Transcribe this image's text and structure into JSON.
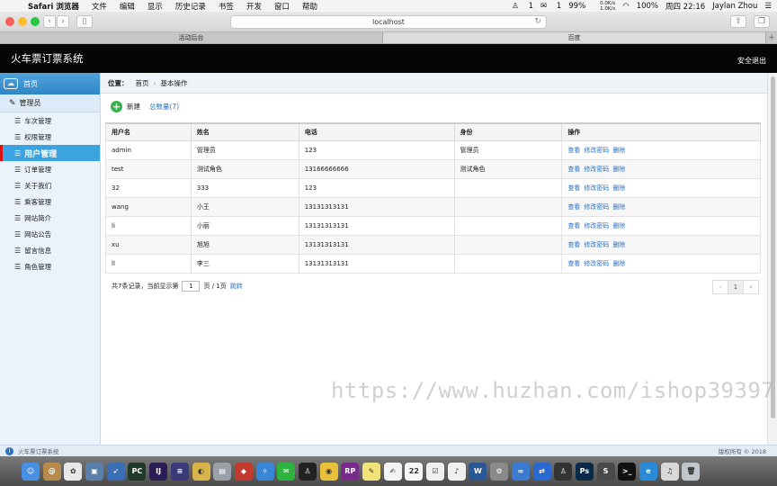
{
  "menubar": {
    "app": "Safari 浏览器",
    "items": [
      "文件",
      "编辑",
      "显示",
      "历史记录",
      "书签",
      "开发",
      "窗口",
      "帮助"
    ],
    "status": {
      "qq_count": "1",
      "wechat_count": "1",
      "percent": "99%",
      "net_up": "0.0K/s",
      "net_down": "1.0K/s",
      "battery": "100%",
      "clock": "周四 22:16",
      "user": "Jaylan Zhou"
    }
  },
  "browser": {
    "url": "localhost",
    "tabs": [
      "活动后台",
      "百度"
    ]
  },
  "header": {
    "title": "火车票订票系统",
    "logout": "安全退出"
  },
  "sidebar": {
    "home": "首页",
    "section": "管理员",
    "items": [
      "车次管理",
      "权限管理",
      "用户管理",
      "订单管理",
      "关于我们",
      "乘客管理",
      "网站简介",
      "网站公告",
      "留言信息",
      "角色管理"
    ],
    "active_index": 2
  },
  "breadcrumb": {
    "label": "位置：",
    "home": "首页",
    "current": "基本操作"
  },
  "actions": {
    "new": "新建",
    "total": "总数量(7)"
  },
  "table": {
    "columns": [
      "用户名",
      "姓名",
      "电话",
      "身份",
      "操作"
    ],
    "rows": [
      {
        "username": "admin",
        "name": "管理员",
        "phone": "123",
        "role": "管理员"
      },
      {
        "username": "test",
        "name": "测试角色",
        "phone": "13166666666",
        "role": "测试角色"
      },
      {
        "username": "32",
        "name": "333",
        "phone": "123",
        "role": ""
      },
      {
        "username": "wang",
        "name": "小王",
        "phone": "13131313131",
        "role": ""
      },
      {
        "username": "li",
        "name": "小丽",
        "phone": "13131313131",
        "role": ""
      },
      {
        "username": "xu",
        "name": "旭旭",
        "phone": "13131313131",
        "role": ""
      },
      {
        "username": "ll",
        "name": "李三",
        "phone": "13131313131",
        "role": ""
      }
    ],
    "ops": [
      "查看",
      "修改密码",
      "删除"
    ]
  },
  "pager": {
    "summary": "共7条记录，当前显示第",
    "page": "1",
    "of": "页 / 1页",
    "jump": "跳转",
    "current": "1",
    "prev": "‹",
    "next": "›"
  },
  "watermark": "https://www.huzhan.com/ishop39397",
  "statusbar": {
    "left": "火车票订票系统",
    "right": "版权所有 © 2018"
  },
  "dock": [
    {
      "name": "finder-icon",
      "color": "#4a90e2",
      "glyph": "☺"
    },
    {
      "name": "contacts-icon",
      "color": "#b88a4a",
      "glyph": "@"
    },
    {
      "name": "photos-icon",
      "color": "#e8e8e8",
      "glyph": "✿"
    },
    {
      "name": "preview-icon",
      "color": "#5a7fa8",
      "glyph": "▣"
    },
    {
      "name": "launchpad-icon",
      "color": "#3b6fb5",
      "glyph": "➶"
    },
    {
      "name": "pycharm-icon",
      "color": "#1f3a2a",
      "glyph": "PC"
    },
    {
      "name": "intellij-icon",
      "color": "#2b1d55",
      "glyph": "IJ"
    },
    {
      "name": "eclipse-icon",
      "color": "#3a3a7a",
      "glyph": "≡"
    },
    {
      "name": "squirrel-icon",
      "color": "#d8b44a",
      "glyph": "◐"
    },
    {
      "name": "db-icon",
      "color": "#9aa0a8",
      "glyph": "▤"
    },
    {
      "name": "redis-icon",
      "color": "#c23a2e",
      "glyph": "◆"
    },
    {
      "name": "safari-icon",
      "color": "#3a86d6",
      "glyph": "✧"
    },
    {
      "name": "wechat-icon",
      "color": "#2fb33f",
      "glyph": "✉"
    },
    {
      "name": "qq-icon",
      "color": "#222222",
      "glyph": "♙"
    },
    {
      "name": "chrome-icon",
      "color": "#e8c13a",
      "glyph": "◉"
    },
    {
      "name": "axure-icon",
      "color": "#7a2a8a",
      "glyph": "RP"
    },
    {
      "name": "notes-icon",
      "color": "#f2e27a",
      "glyph": "✎"
    },
    {
      "name": "textedit-icon",
      "color": "#f4f4f4",
      "glyph": "✍"
    },
    {
      "name": "calendar-icon",
      "color": "#f8f8f8",
      "glyph": "22"
    },
    {
      "name": "reminders-icon",
      "color": "#f0f0f0",
      "glyph": "☑"
    },
    {
      "name": "music-icon",
      "color": "#f0f0f0",
      "glyph": "♪"
    },
    {
      "name": "word-icon",
      "color": "#2b5797",
      "glyph": "W"
    },
    {
      "name": "settings-icon",
      "color": "#8a8a8a",
      "glyph": "⚙"
    },
    {
      "name": "baidu-netdisk-icon",
      "color": "#3a7ad0",
      "glyph": "∞"
    },
    {
      "name": "teamviewer-icon",
      "color": "#2a6ad0",
      "glyph": "⇄"
    },
    {
      "name": "qq2-icon",
      "color": "#333333",
      "glyph": "♙"
    },
    {
      "name": "photoshop-icon",
      "color": "#0a2a4a",
      "glyph": "Ps"
    },
    {
      "name": "sublime-icon",
      "color": "#4a4a4a",
      "glyph": "S"
    },
    {
      "name": "terminal-icon",
      "color": "#111111",
      "glyph": ">_"
    },
    {
      "name": "edge-icon",
      "color": "#2a8ad8",
      "glyph": "e"
    },
    {
      "name": "itunes-icon",
      "color": "#d8d8d8",
      "glyph": "♫"
    },
    {
      "name": "trash-icon",
      "color": "#bfc6cc",
      "glyph": "🗑"
    }
  ]
}
